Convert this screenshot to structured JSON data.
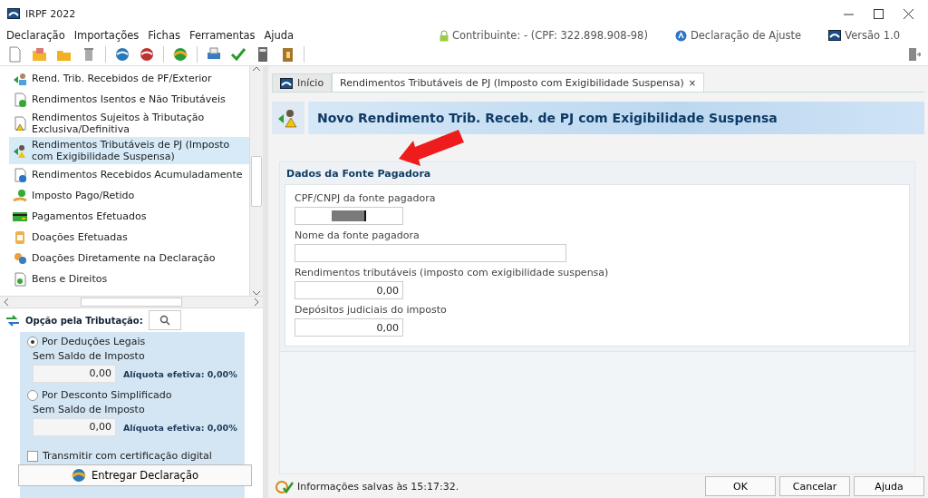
{
  "window": {
    "title": "IRPF 2022"
  },
  "menu": [
    "Declaração",
    "Importações",
    "Fichas",
    "Ferramentas",
    "Ajuda"
  ],
  "info": {
    "contribuinte": "Contribuinte:  - (CPF: 322.898.908-98)",
    "declaracao": "Declaração de Ajuste",
    "versao": "Versão 1.0"
  },
  "sidebar": {
    "items": [
      {
        "label": "Rend. Trib. Recebidos de PF/Exterior",
        "selected": false
      },
      {
        "label": "Rendimentos Isentos e Não Tributáveis",
        "selected": false
      },
      {
        "label": "Rendimentos Sujeitos à Tributação Exclusiva/Definitiva",
        "selected": false
      },
      {
        "label": "Rendimentos Tributáveis de PJ (Imposto com Exigibilidade Suspensa)",
        "selected": true
      },
      {
        "label": "Rendimentos Recebidos Acumuladamente",
        "selected": false
      },
      {
        "label": "Imposto Pago/Retido",
        "selected": false
      },
      {
        "label": "Pagamentos Efetuados",
        "selected": false
      },
      {
        "label": "Doações Efetuadas",
        "selected": false
      },
      {
        "label": "Doações Diretamente na Declaração",
        "selected": false
      },
      {
        "label": "Bens e Direitos",
        "selected": false
      }
    ],
    "tributacao": {
      "label": "Opção pela Tributação:",
      "options": [
        {
          "label": "Por Deduções Legais",
          "selected": true,
          "saldo_label": "Sem Saldo de Imposto",
          "value": "0,00",
          "aliquota": "Alíquota efetiva: 0,00%"
        },
        {
          "label": "Por Desconto Simplificado",
          "selected": false,
          "saldo_label": "Sem Saldo de Imposto",
          "value": "0,00",
          "aliquota": "Alíquota efetiva: 0,00%"
        }
      ]
    },
    "certificacao": {
      "label": "Transmitir com certificação digital",
      "checked": false
    },
    "entregar": "Entregar Declaração"
  },
  "tabs": [
    {
      "label": "Início",
      "selected": false
    },
    {
      "label": "Rendimentos Tributáveis de PJ (Imposto com Exigibilidade Suspensa)",
      "selected": true,
      "close": "×"
    }
  ],
  "header": {
    "title": "Novo Rendimento Trib. Receb. de PJ com Exigibilidade Suspensa"
  },
  "section": {
    "title": "Dados da Fonte Pagadora",
    "fields": [
      {
        "label": "CPF/CNPJ da fonte pagadora",
        "kind": "redacted"
      },
      {
        "label": "Nome da fonte pagadora",
        "kind": "text"
      },
      {
        "label": "Rendimentos tributáveis (imposto com exigibilidade suspensa)",
        "kind": "money",
        "value": "0,00"
      },
      {
        "label": "Depósitos judiciais do imposto",
        "kind": "money",
        "value": "0,00"
      }
    ]
  },
  "status_bar": {
    "message": "Informações salvas às 15:17:32."
  },
  "buttons": [
    "OK",
    "Cancelar",
    "Ajuda"
  ]
}
